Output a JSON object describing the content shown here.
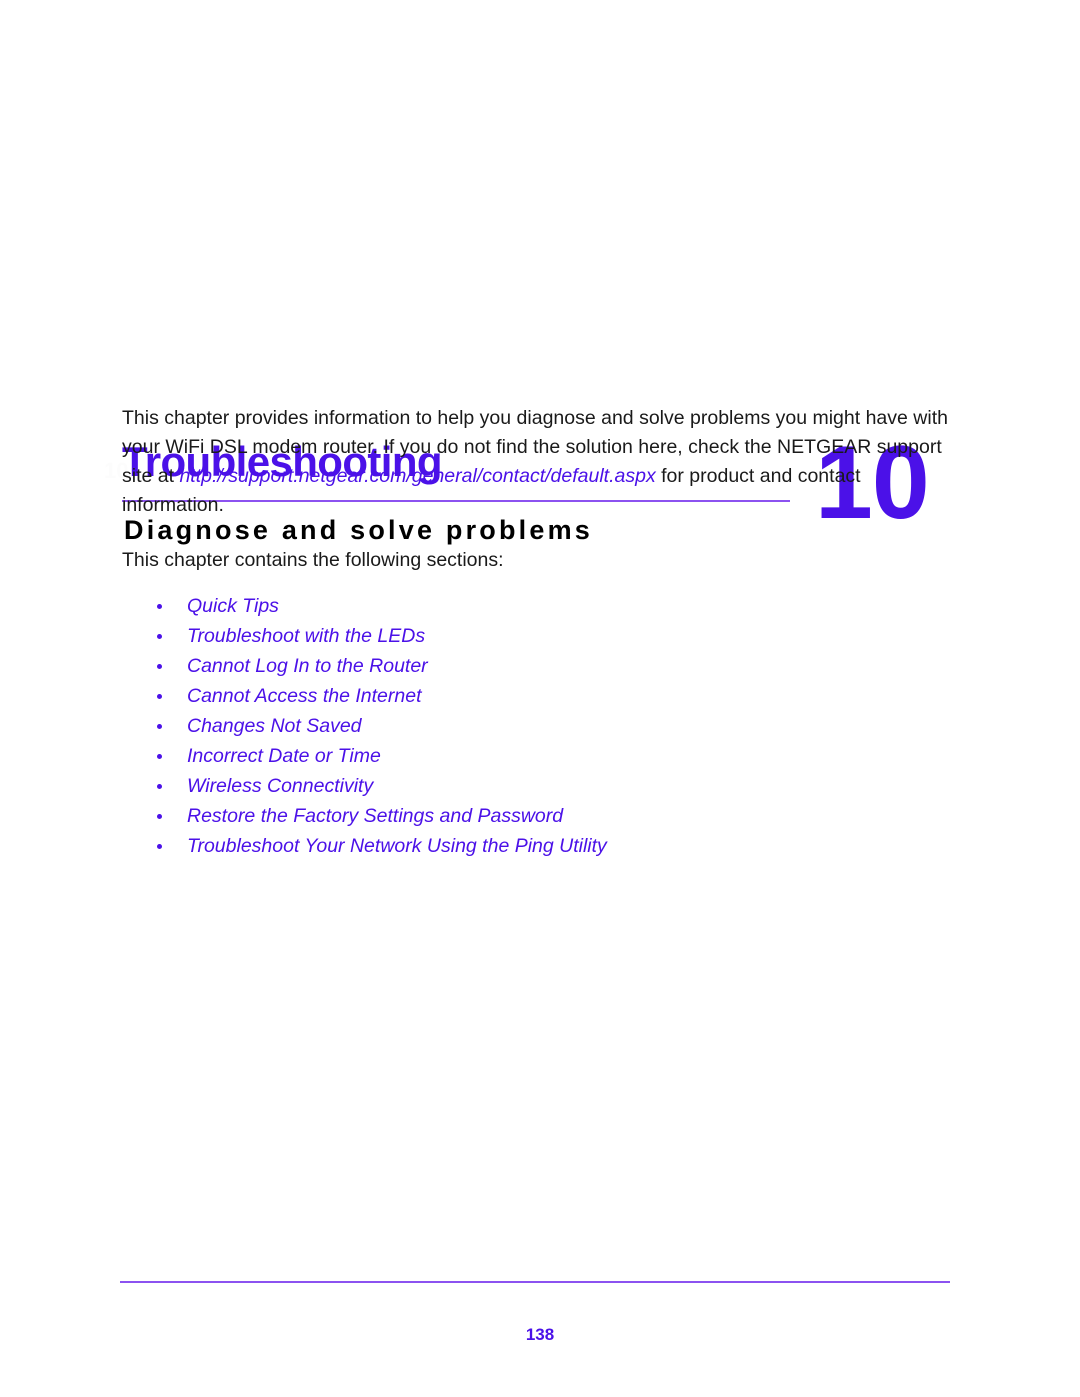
{
  "document": {
    "chapter_number": "10",
    "chapter_title": "Troubleshooting",
    "chapter_subtitle": "Diagnose and solve problems",
    "chapter_watermark": "10."
  },
  "intro": {
    "text_before_link": "This chapter provides information to help you diagnose and solve problems you might have with your WiFi DSL modem router. If you do not find the solution here, check the NETGEAR support site at ",
    "link_text": "http://support.netgear.com/general/contact/default.aspx",
    "text_after_link": " for product and contact information.",
    "sections_lead": "This chapter contains the following sections:"
  },
  "sections": [
    {
      "label": "Quick Tips"
    },
    {
      "label": "Troubleshoot with the LEDs"
    },
    {
      "label": "Cannot Log In to the Router"
    },
    {
      "label": "Cannot Access the Internet"
    },
    {
      "label": "Changes Not Saved"
    },
    {
      "label": "Incorrect Date or Time"
    },
    {
      "label": "Wireless Connectivity"
    },
    {
      "label": "Restore the Factory Settings and Password"
    },
    {
      "label": "Troubleshoot Your Network Using the Ping Utility"
    }
  ],
  "footer": {
    "page_number": "138"
  },
  "colors": {
    "accent_purple": "#4b11e8",
    "rule_purple": "#8c52f0",
    "body_text": "#1a1a1a"
  }
}
